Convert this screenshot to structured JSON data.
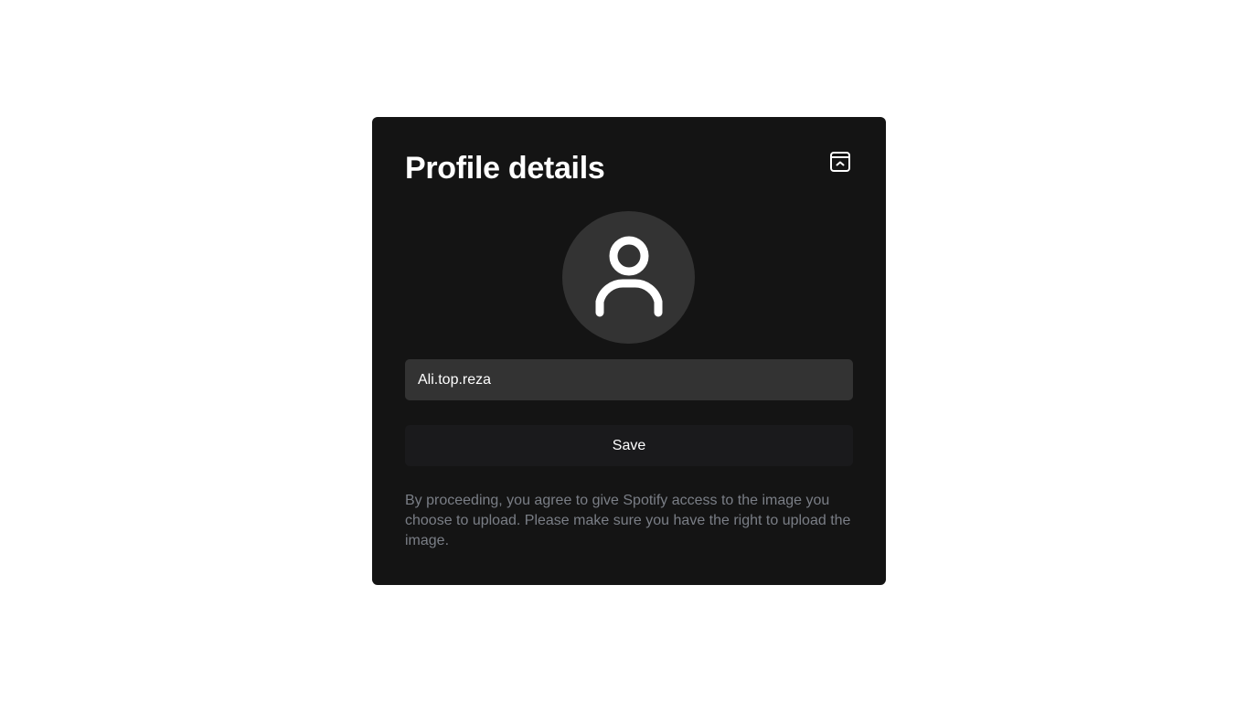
{
  "dialog": {
    "title": "Profile details",
    "collapse_icon": "collapse-up-icon",
    "avatar_icon": "user-icon",
    "name_input": {
      "value": "Ali.top.reza",
      "placeholder": ""
    },
    "save_label": "Save",
    "disclaimer": "By proceeding, you agree to give Spotify access to the image you choose to upload. Please make sure you have the right to upload the image."
  },
  "colors": {
    "page_background": "#ffffff",
    "dialog_background": "#141414",
    "input_background": "#333333",
    "button_background": "#1a1a1c",
    "disclaimer_text": "#7a7e86"
  }
}
